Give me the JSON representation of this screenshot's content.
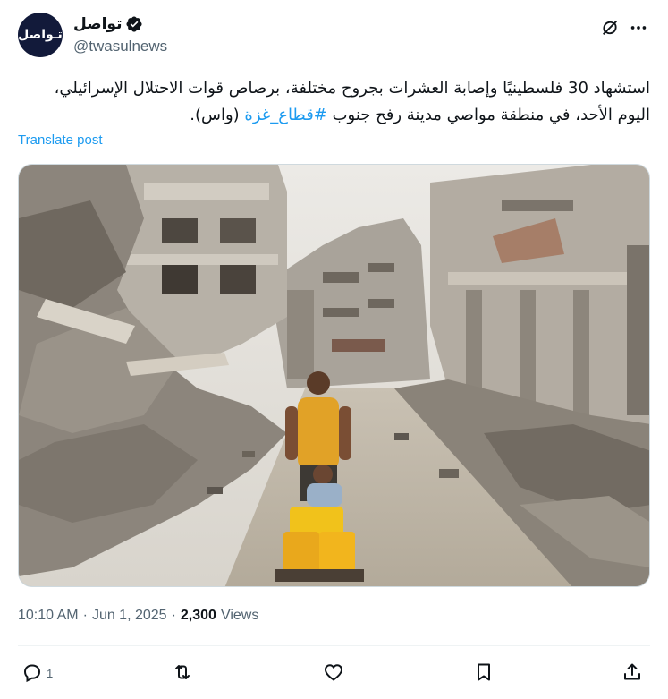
{
  "author": {
    "display_name": "تواصل",
    "handle": "@twasulnews",
    "avatar_mark": "تـواصل",
    "avatar_color": "#121a3a",
    "verified": true,
    "verified_color": "#0f1419"
  },
  "header_icons": {
    "grok": "grok-icon",
    "more": "more-icon"
  },
  "tweet": {
    "text_main": "استشهاد 30 فلسطينيًا وإصابة العشرات بجروح مختلفة، برصاص قوات الاحتلال الإسرائيلي، اليوم الأحد، في منطقة مواصي مدينة رفح جنوب ",
    "hashtag": "#قطاع_غزة",
    "text_end": " (واس).",
    "translate_label": "Translate post",
    "link_color": "#1d9bf0"
  },
  "meta": {
    "time": "10:10 AM",
    "date": "Jun 1, 2025",
    "separator": "·",
    "views_count": "2,300",
    "views_label": "Views"
  },
  "actions": {
    "reply": {
      "icon": "reply-icon",
      "count": "1"
    },
    "retweet": {
      "icon": "retweet-icon",
      "count": ""
    },
    "like": {
      "icon": "heart-icon",
      "count": ""
    },
    "bookmark": {
      "icon": "bookmark-icon",
      "count": ""
    },
    "share": {
      "icon": "share-icon",
      "count": ""
    }
  },
  "media": {
    "description_icon": "photo"
  }
}
